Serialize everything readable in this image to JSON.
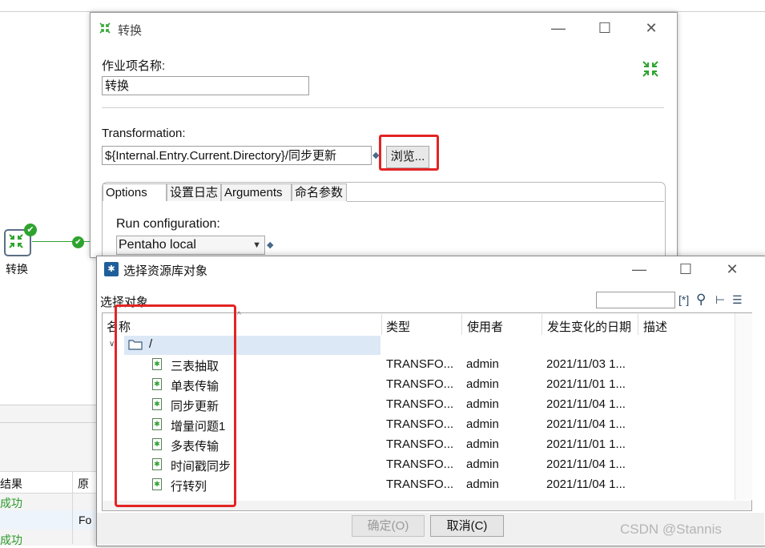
{
  "background": {
    "step_label": "转换",
    "results_header": [
      "结果",
      "原"
    ],
    "result_rows": [
      "成功",
      "Fo",
      "成功"
    ]
  },
  "dialog_transformation": {
    "title": "转换",
    "job_entry_name_label": "作业项名称:",
    "job_entry_name_value": "转换",
    "transformation_label": "Transformation:",
    "transformation_path": "${Internal.Entry.Current.Directory}/同步更新",
    "browse_button": "浏览...",
    "tabs": [
      "Options",
      "设置日志",
      "Arguments",
      "命名参数"
    ],
    "run_config_label": "Run configuration:",
    "run_config_value": "Pentaho local",
    "window_controls": {
      "minimize": "—",
      "maximize": "☐",
      "close": "✕"
    }
  },
  "dialog_repository": {
    "title": "选择资源库对象",
    "select_object_label": "选择对象",
    "filter_value": "",
    "columns": [
      "名称",
      "类型",
      "使用者",
      "发生变化的日期",
      "描述"
    ],
    "root_folder": "/",
    "rows": [
      {
        "name": "三表抽取",
        "type": "TRANSFO...",
        "user": "admin",
        "date": "2021/11/03 1..."
      },
      {
        "name": "单表传输",
        "type": "TRANSFO...",
        "user": "admin",
        "date": "2021/11/01 1..."
      },
      {
        "name": "同步更新",
        "type": "TRANSFO...",
        "user": "admin",
        "date": "2021/11/04 1..."
      },
      {
        "name": "增量问题1",
        "type": "TRANSFO...",
        "user": "admin",
        "date": "2021/11/04 1..."
      },
      {
        "name": "多表传输",
        "type": "TRANSFO...",
        "user": "admin",
        "date": "2021/11/01 1..."
      },
      {
        "name": "时间戳同步",
        "type": "TRANSFO...",
        "user": "admin",
        "date": "2021/11/04 1..."
      },
      {
        "name": "行转列",
        "type": "TRANSFO...",
        "user": "admin",
        "date": "2021/11/04 1..."
      }
    ],
    "ok_button": "确定(O)",
    "cancel_button": "取消(C)",
    "window_controls": {
      "minimize": "—",
      "maximize": "☐",
      "close": "✕"
    }
  },
  "watermark": "CSDN @Stannis",
  "colors": {
    "highlight_red": "#e32424",
    "success_green": "#2fa32f",
    "selection_blue": "#dce8f5"
  }
}
